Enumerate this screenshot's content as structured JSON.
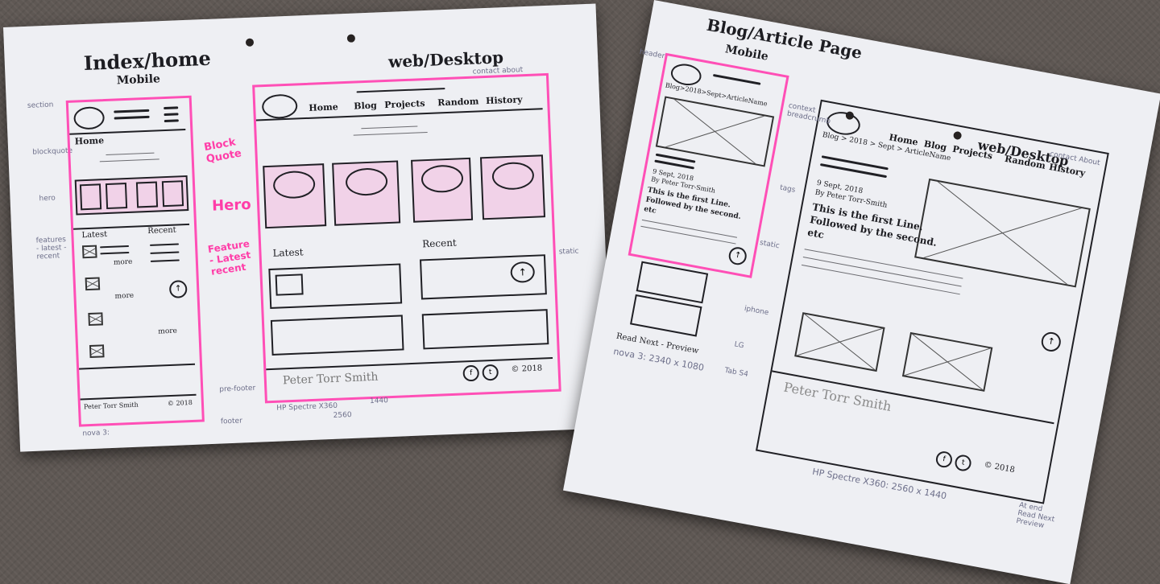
{
  "left_sheet": {
    "title": "Index/home",
    "mobile_label": "Mobile",
    "desktop_label": "web/Desktop",
    "nav": [
      "Home",
      "Blog",
      "Projects",
      "Random",
      "History"
    ],
    "contact_about": "contact about",
    "mobile_home": "Home",
    "latest": "Latest",
    "recent": "Recent",
    "more": "more",
    "footer_name": "Peter Torr Smith",
    "copyright": "© 2018",
    "pink_notes": [
      "Block Quote",
      "Hero",
      "Feature - Latest recent"
    ],
    "side_notes": [
      "section",
      "blockquote",
      "hero",
      "features - latest - recent",
      "pre-footer",
      "footer",
      "static"
    ],
    "device_notes": [
      "HP Spectre X360",
      "2560",
      "1440",
      "nova 3:"
    ]
  },
  "right_sheet": {
    "title": "Blog/Article Page",
    "mobile_label": "Mobile",
    "desktop_label": "web/Desktop",
    "breadcrumb_mobile": "Blog>2018>Sept>ArticleName",
    "breadcrumb_desktop": "Blog > 2018 > Sept > ArticleName",
    "nav": [
      "Home",
      "Blog",
      "Projects",
      "Random",
      "History"
    ],
    "contact_about": "contact About",
    "date": "9 Sept, 2018",
    "author": "By Peter Torr-Smith",
    "first_line": "This is the first Line.",
    "second_line": "Followed by the second.",
    "etc": "etc",
    "read_next": "Read Next - Preview",
    "footer_name": "Peter Torr Smith",
    "copyright": "© 2018",
    "side_notes": [
      "context breadcrumb",
      "tags",
      "static",
      "iphone",
      "LG",
      "Tab S4",
      "header"
    ],
    "device_notes": [
      "HP Spectre X360: 2560 x 1440",
      "nova 3: 2340 x 1080",
      "At end Read Next Preview"
    ]
  }
}
